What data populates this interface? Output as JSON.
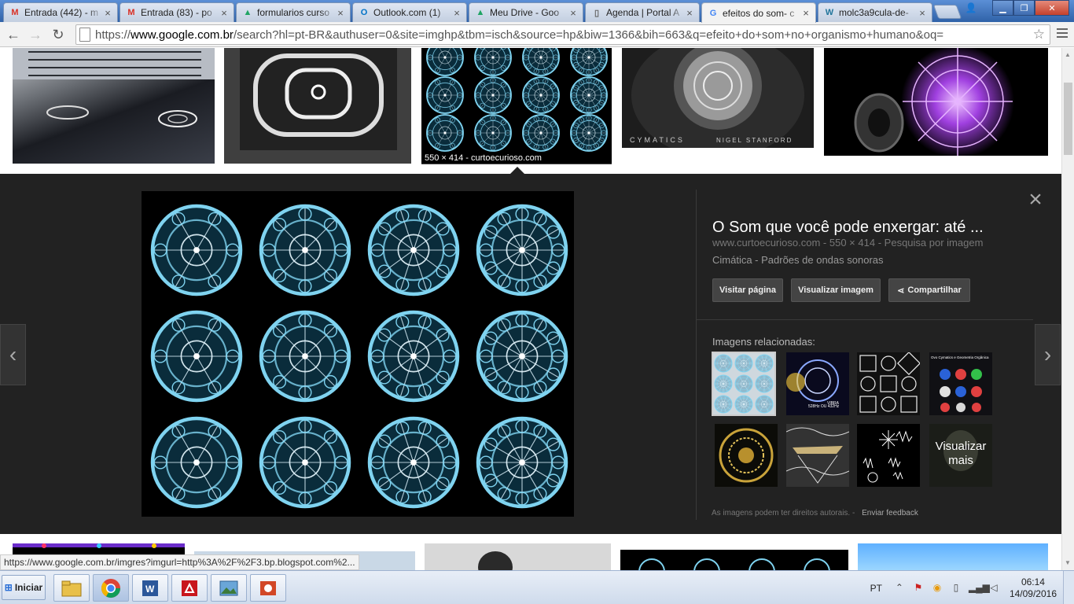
{
  "browser": {
    "tabs": [
      {
        "label": "Entrada (442) - m",
        "icon": "gmail-icon",
        "icon_glyph": "M",
        "icon_color": "#d93025"
      },
      {
        "label": "Entrada (83) - po",
        "icon": "gmail-icon",
        "icon_glyph": "M",
        "icon_color": "#d93025"
      },
      {
        "label": "formularios curso",
        "icon": "google-drive-icon",
        "icon_glyph": "▲",
        "icon_color": "#1fa463"
      },
      {
        "label": "Outlook.com (1)",
        "icon": "outlook-icon",
        "icon_glyph": "O",
        "icon_color": "#0072c6"
      },
      {
        "label": "Meu Drive - Goo",
        "icon": "google-drive-icon",
        "icon_glyph": "▲",
        "icon_color": "#1fa463"
      },
      {
        "label": "Agenda | Portal A",
        "icon": "page-icon",
        "icon_glyph": "▯",
        "icon_color": "#666666"
      },
      {
        "label": "efeitos do som- c",
        "icon": "google-icon",
        "icon_glyph": "G",
        "icon_color": "#4285f4",
        "active": true
      },
      {
        "label": "molc3a9cula-de-",
        "icon": "wordpress-icon",
        "icon_glyph": "W",
        "icon_color": "#21759b"
      }
    ],
    "tab_close_glyph": "×",
    "address": {
      "scheme": "https://",
      "host": "www.google.com.br",
      "path": "/search?hl=pt-BR&authuser=0&site=imghp&tbm=isch&source=hp&biw=1366&bih=663&q=efeito+do+som+no+organismo+humano&oq="
    },
    "status_url": "https://www.google.com.br/imgres?imgurl=http%3A%2F%2F3.bp.blogspot.com%2..."
  },
  "results": {
    "selected_caption": "550 × 414 - curtoecurioso.com"
  },
  "preview": {
    "title": "O Som que você pode enxergar: até ...",
    "source": "www.curtoecurioso.com",
    "dimensions": "550 × 414",
    "search_by_image": "Pesquisa por imagem",
    "meta_sep": "-",
    "description": "Cimática - Padrões de ondas sonoras",
    "buttons": {
      "visit": "Visitar página",
      "view": "Visualizar imagem",
      "share": "Compartilhar"
    },
    "related_title": "Imagens relacionadas:",
    "view_more": "Visualizar mais",
    "rights_note": "As imagens podem ter direitos autorais.",
    "feedback": "Enviar feedback",
    "prev_glyph": "‹",
    "next_glyph": "›",
    "close_glyph": "×",
    "thumb_texts": {
      "cymatics": "CYMATICS",
      "nigel": "NIGEL STANFORD",
      "rel2_a": "528Hz OU 432Hz",
      "rel2_b": "VIBRA",
      "rel4_a": "Ovo Cymatics e Geometria Orgânica"
    }
  },
  "taskbar": {
    "start_label": "Iniciar",
    "language": "PT",
    "time": "06:14",
    "date": "14/09/2016"
  },
  "colors": {
    "cymatic": "#7fd3f0",
    "cymatic_glow": "#1e7fa8",
    "preview_bg": "#222222"
  }
}
